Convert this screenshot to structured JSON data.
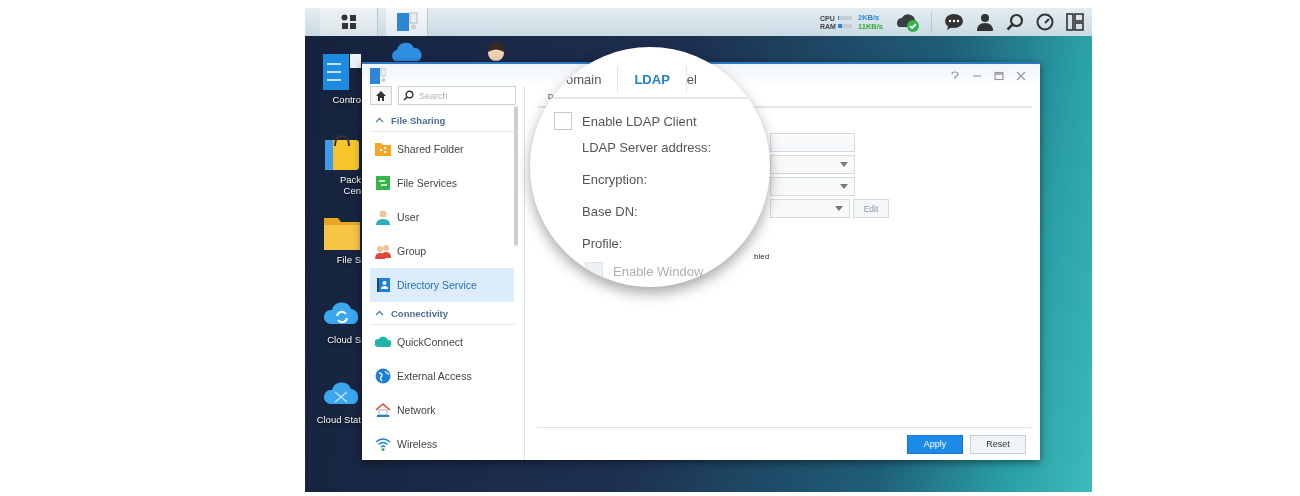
{
  "taskbar": {
    "meters": [
      {
        "label": "CPU",
        "level": 0.08
      },
      {
        "label": "RAM",
        "level": 0.3
      }
    ],
    "upload": "2KB/s",
    "download": "11KB/s"
  },
  "desktop_icons": [
    {
      "kind": "control-panel",
      "label_lines": [
        "Contro"
      ]
    },
    {
      "kind": "package",
      "label_lines": [
        "Pack",
        "Cen"
      ]
    },
    {
      "kind": "folder",
      "label_lines": [
        "File S"
      ]
    },
    {
      "kind": "cloud-sync",
      "label_lines": [
        "Cloud S"
      ]
    },
    {
      "kind": "cloud-station",
      "label_lines": [
        "Cloud Stat"
      ]
    },
    {
      "kind": "cloud"
    },
    {
      "kind": "avatar"
    }
  ],
  "sidebar": {
    "search_placeholder": "Search",
    "sections": [
      {
        "title": "File Sharing",
        "expanded": true,
        "items": [
          {
            "label": "Shared Folder",
            "kind": "shared-folder",
            "selected": false
          },
          {
            "label": "File Services",
            "kind": "file-services",
            "selected": false
          },
          {
            "label": "User",
            "kind": "user",
            "selected": false
          },
          {
            "label": "Group",
            "kind": "group",
            "selected": false
          },
          {
            "label": "Directory Service",
            "kind": "directory",
            "selected": true
          }
        ]
      },
      {
        "title": "Connectivity",
        "expanded": true,
        "items": [
          {
            "label": "QuickConnect",
            "kind": "quickconnect",
            "selected": false
          },
          {
            "label": "External Access",
            "kind": "globe",
            "selected": false
          },
          {
            "label": "Network",
            "kind": "network",
            "selected": false
          },
          {
            "label": "Wireless",
            "kind": "wifi",
            "selected": false
          }
        ]
      }
    ]
  },
  "tabs": [
    {
      "label": "omain",
      "selected": false
    },
    {
      "label": "LDAP",
      "selected": true
    },
    {
      "label": "el",
      "selected": false
    }
  ],
  "subtab": "D",
  "form": {
    "enable_checkbox": {
      "label": "Enable LDAP Client",
      "checked": false
    },
    "fields": [
      {
        "label": "LDAP Server address:",
        "kind": "text"
      },
      {
        "label": "Encryption:",
        "kind": "select"
      },
      {
        "label": "Base DN:",
        "kind": "select"
      },
      {
        "label": "Profile:",
        "kind": "select",
        "button": "Edit"
      }
    ],
    "note": "bled",
    "windows_checkbox": {
      "label": "Enable Window",
      "checked": false,
      "disabled": true
    }
  },
  "buttons": [
    {
      "label": "Apply",
      "kind": "primary"
    },
    {
      "label": "Reset",
      "kind": "secondary"
    }
  ]
}
